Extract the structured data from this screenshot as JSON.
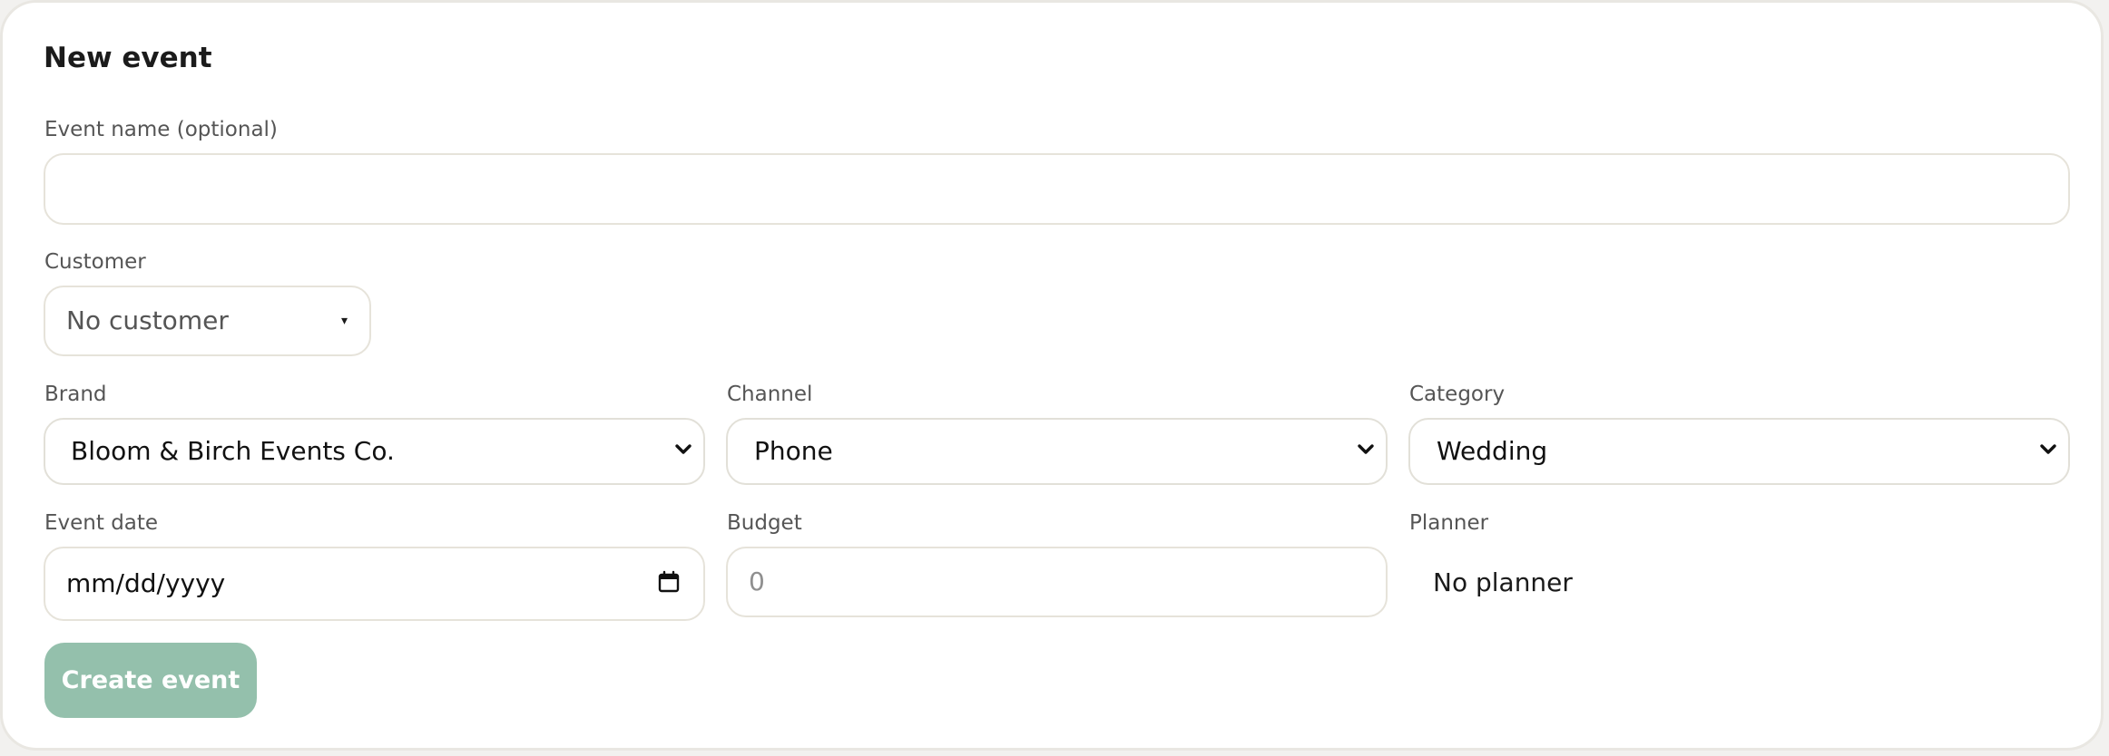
{
  "form": {
    "title": "New event",
    "event_name": {
      "label": "Event name (optional)",
      "value": "",
      "placeholder": ""
    },
    "customer": {
      "label": "Customer",
      "selected": "No customer"
    },
    "brand": {
      "label": "Brand",
      "selected": "Bloom & Birch Events Co."
    },
    "channel": {
      "label": "Channel",
      "selected": "Phone"
    },
    "category": {
      "label": "Category",
      "selected": "Wedding"
    },
    "event_date": {
      "label": "Event date",
      "placeholder": "mm/dd/yyyy"
    },
    "budget": {
      "label": "Budget",
      "placeholder": "0"
    },
    "planner": {
      "label": "Planner",
      "value": "No planner"
    },
    "submit_label": "Create event"
  },
  "icons": {
    "select_chevron": "chevron-down-icon",
    "customer_caret": "caret-down-icon",
    "date_picker": "calendar-icon"
  },
  "colors": {
    "primary_button": "#94c0ac",
    "field_border": "#e6e3da",
    "card_border": "#e9e7e2"
  }
}
